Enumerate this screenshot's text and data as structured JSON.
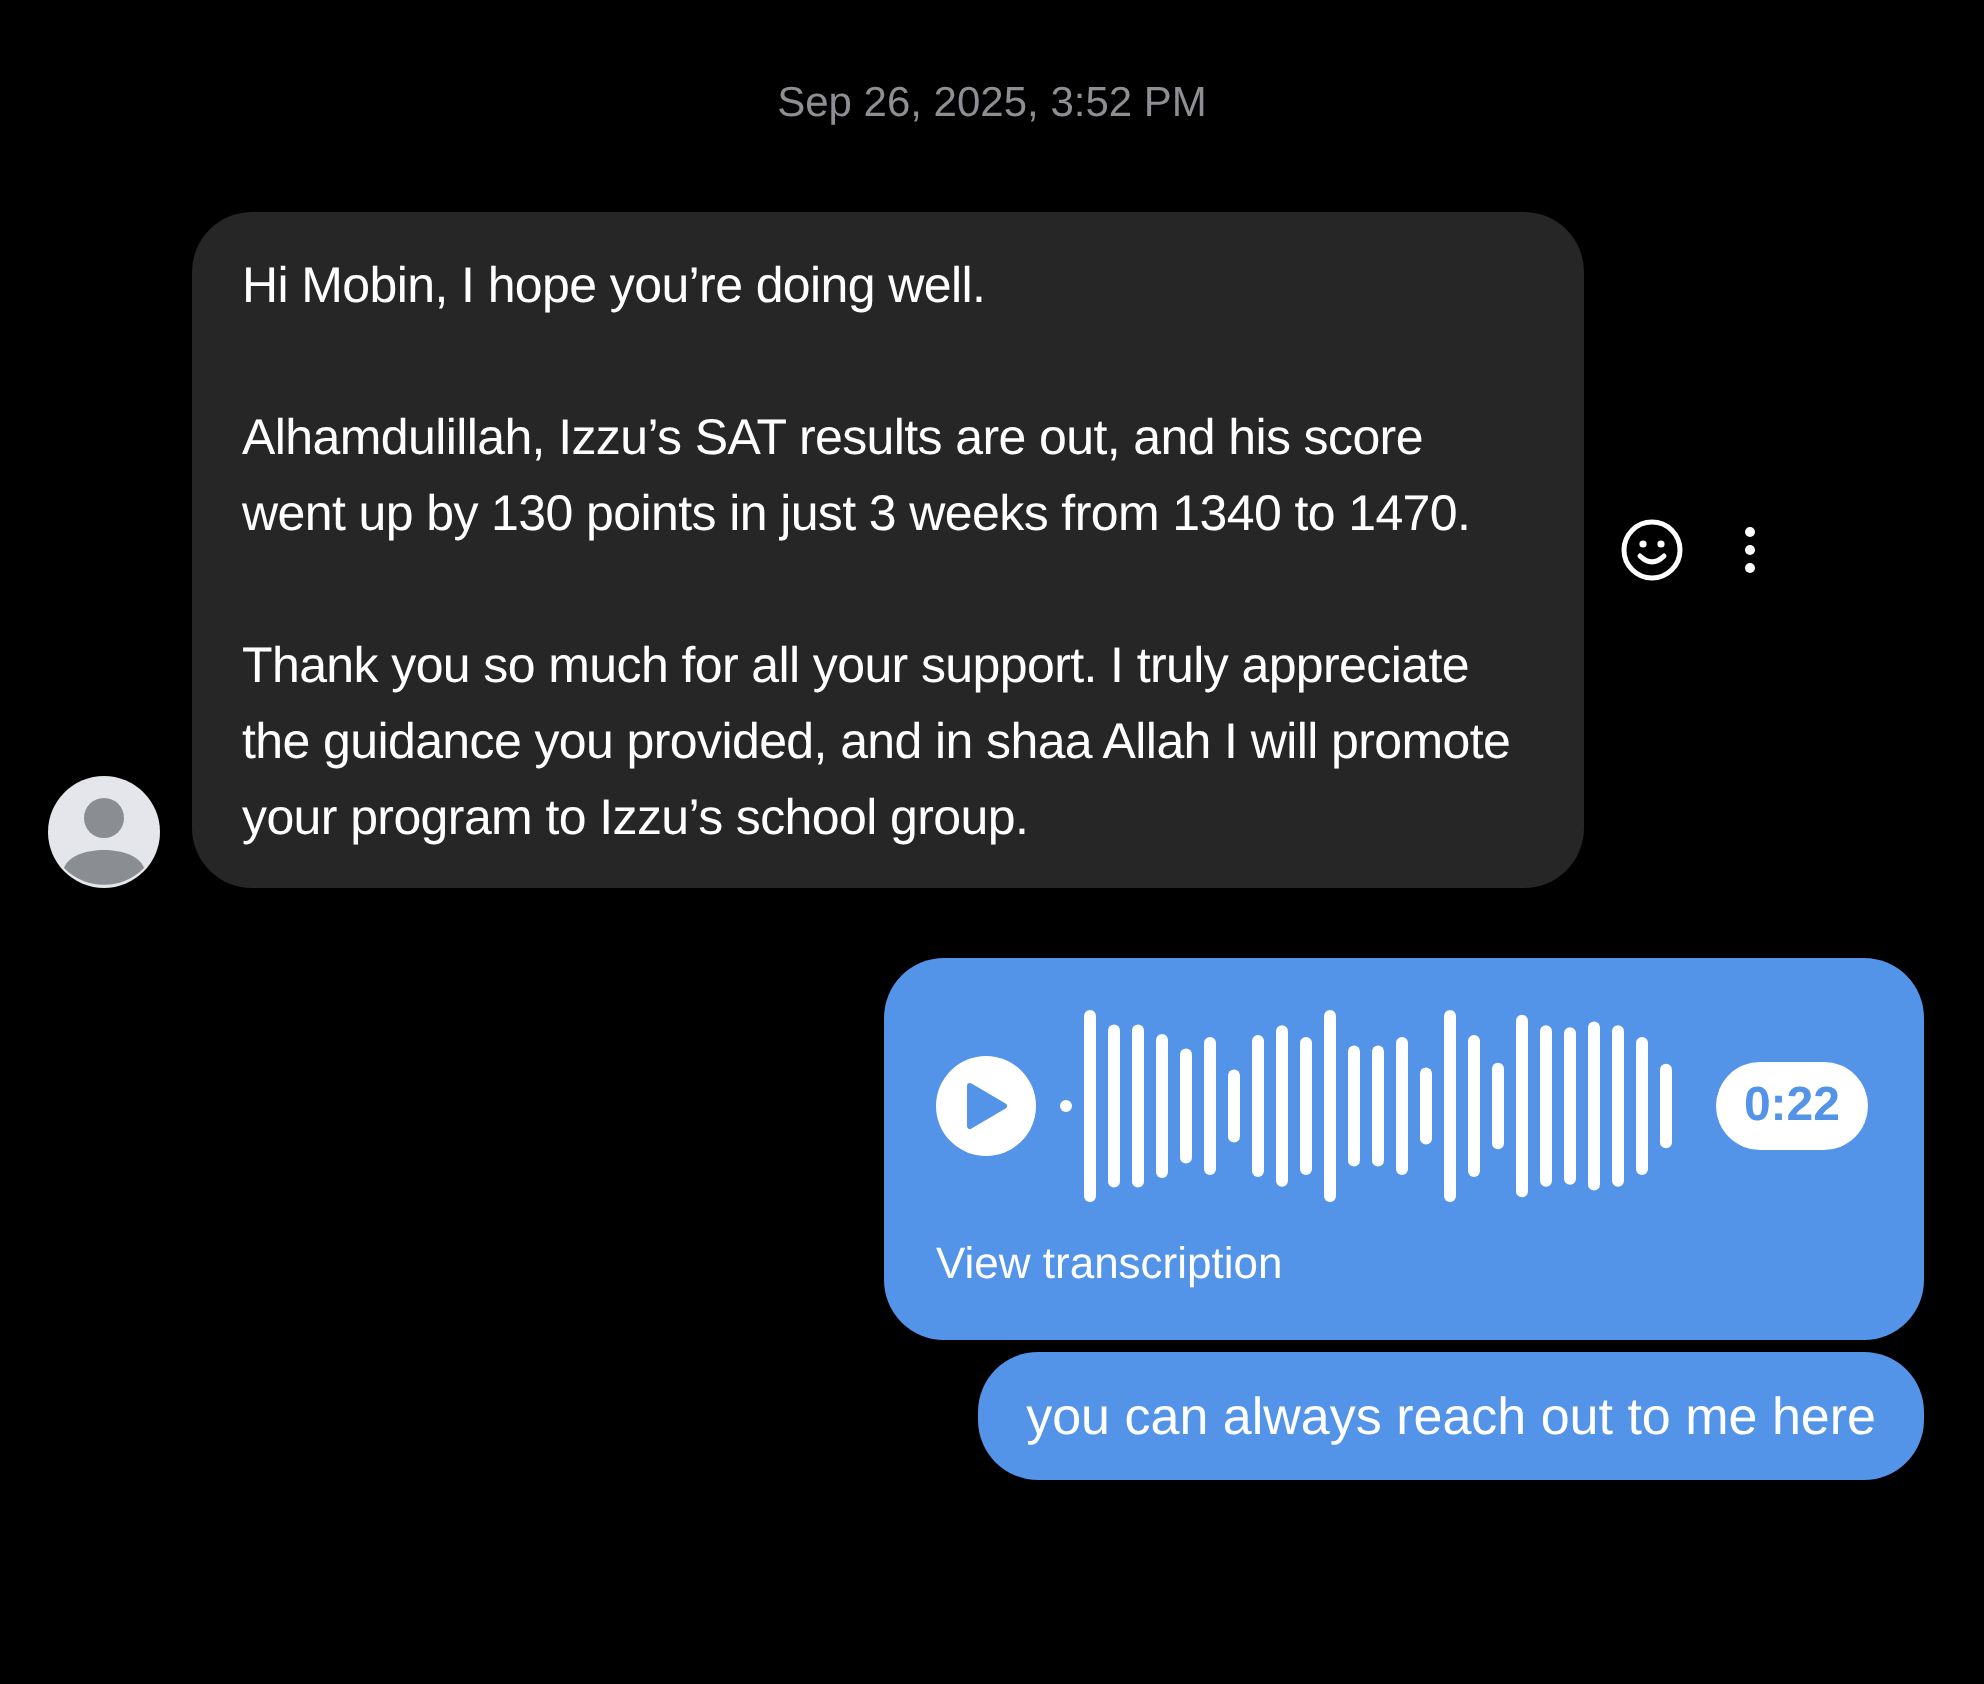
{
  "timestamp": "Sep 26, 2025, 3:52 PM",
  "messages": [
    {
      "kind": "text",
      "outgoing": false,
      "paragraphs": [
        "Hi Mobin, I hope you’re doing well.",
        "Alhamdulillah, Izzu’s SAT results are out, and his score went up by 130 points in just 3 weeks from 1340 to 1470.",
        "Thank you so much for all your support. I truly appreciate the guidance you provided, and in shaa Allah I will promote your program to Izzu’s school group."
      ]
    },
    {
      "kind": "voice",
      "outgoing": true,
      "duration": "0:22",
      "link": "View transcription"
    },
    {
      "kind": "text",
      "outgoing": true,
      "paragraphs": [
        "you can always reach out to me here"
      ]
    }
  ]
}
